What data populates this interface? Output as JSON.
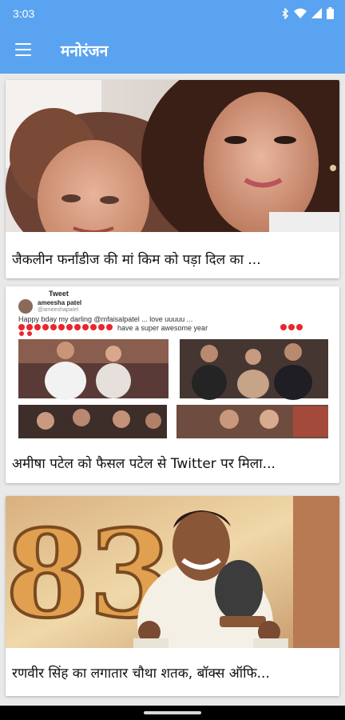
{
  "status_bar": {
    "time": "3:03"
  },
  "app_bar": {
    "title": "मनोरंजन",
    "menu_icon": "hamburger-menu-icon"
  },
  "articles": [
    {
      "title": "जैकलीन फर्नांडीज की मां किम को पड़ा दिल का ..."
    },
    {
      "title": "अमीषा पटेल को फैसल पटेल से Twitter पर मिला...",
      "tweet": {
        "header": "Tweet",
        "user": "ameesha patel",
        "handle": "@ameeshapatel",
        "text": "Happy bday my darling @mfaisalpatel ... love uuuuu ...",
        "text2": "have a super awesome year"
      }
    },
    {
      "title": "रणवीर सिंह का लगातार चौथा शतक, बॉक्स ऑफि...",
      "poster_text": "83"
    }
  ]
}
